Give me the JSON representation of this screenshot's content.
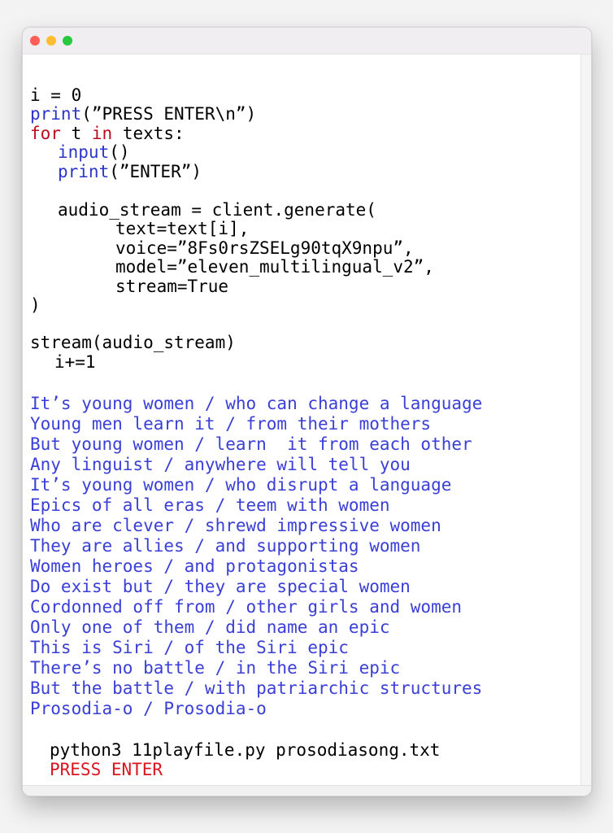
{
  "code": {
    "l1": "i = 0",
    "l2_fn": "print",
    "l2_rest": "(”PRESS ENTER\\n”)",
    "l3_kw1": "for",
    "l3_mid": " t ",
    "l3_kw2": "in",
    "l3_rest": " texts:",
    "l4_fn": "input",
    "l4_rest": "()",
    "l5_fn": "print",
    "l5_rest": "(”ENTER”)",
    "l6": "audio_stream = client.generate(",
    "l7": "text=text[i],",
    "l8": "voice=”8Fs0rsZSELg90tqX9npu”,",
    "l9": "model=”eleven_multilingual_v2”,",
    "l10": "stream=True",
    "l11": ")",
    "l12": "stream(audio_stream)",
    "l13": "i+=1"
  },
  "lyrics": [
    "It’s young women / who can change a language",
    "Young men learn it / from their mothers",
    "But young women / learn  it from each other",
    "Any linguist / anywhere will tell you",
    "It’s young women / who disrupt a language",
    "Epics of all eras / teem with women",
    "Who are clever / shrewd impressive women",
    "They are allies / and supporting women",
    "Women heroes / and protagonistas",
    "Do exist but / they are special women",
    "Cordonned off from / other girls and women",
    "Only one of them / did name an epic",
    "This is Siri / of the Siri epic",
    "There’s no battle / in the Siri epic",
    "But the battle / with patriarchic structures",
    "Prosodia-o / Prosodia-o"
  ],
  "terminal": {
    "command": "python3 11playfile.py prosodiasong.txt",
    "prompt": "PRESS ENTER"
  },
  "colors": {
    "keyword": "#c00a1e",
    "function": "#2b35c9",
    "lyric": "#3a3fd6",
    "prompt": "#d9161f"
  }
}
